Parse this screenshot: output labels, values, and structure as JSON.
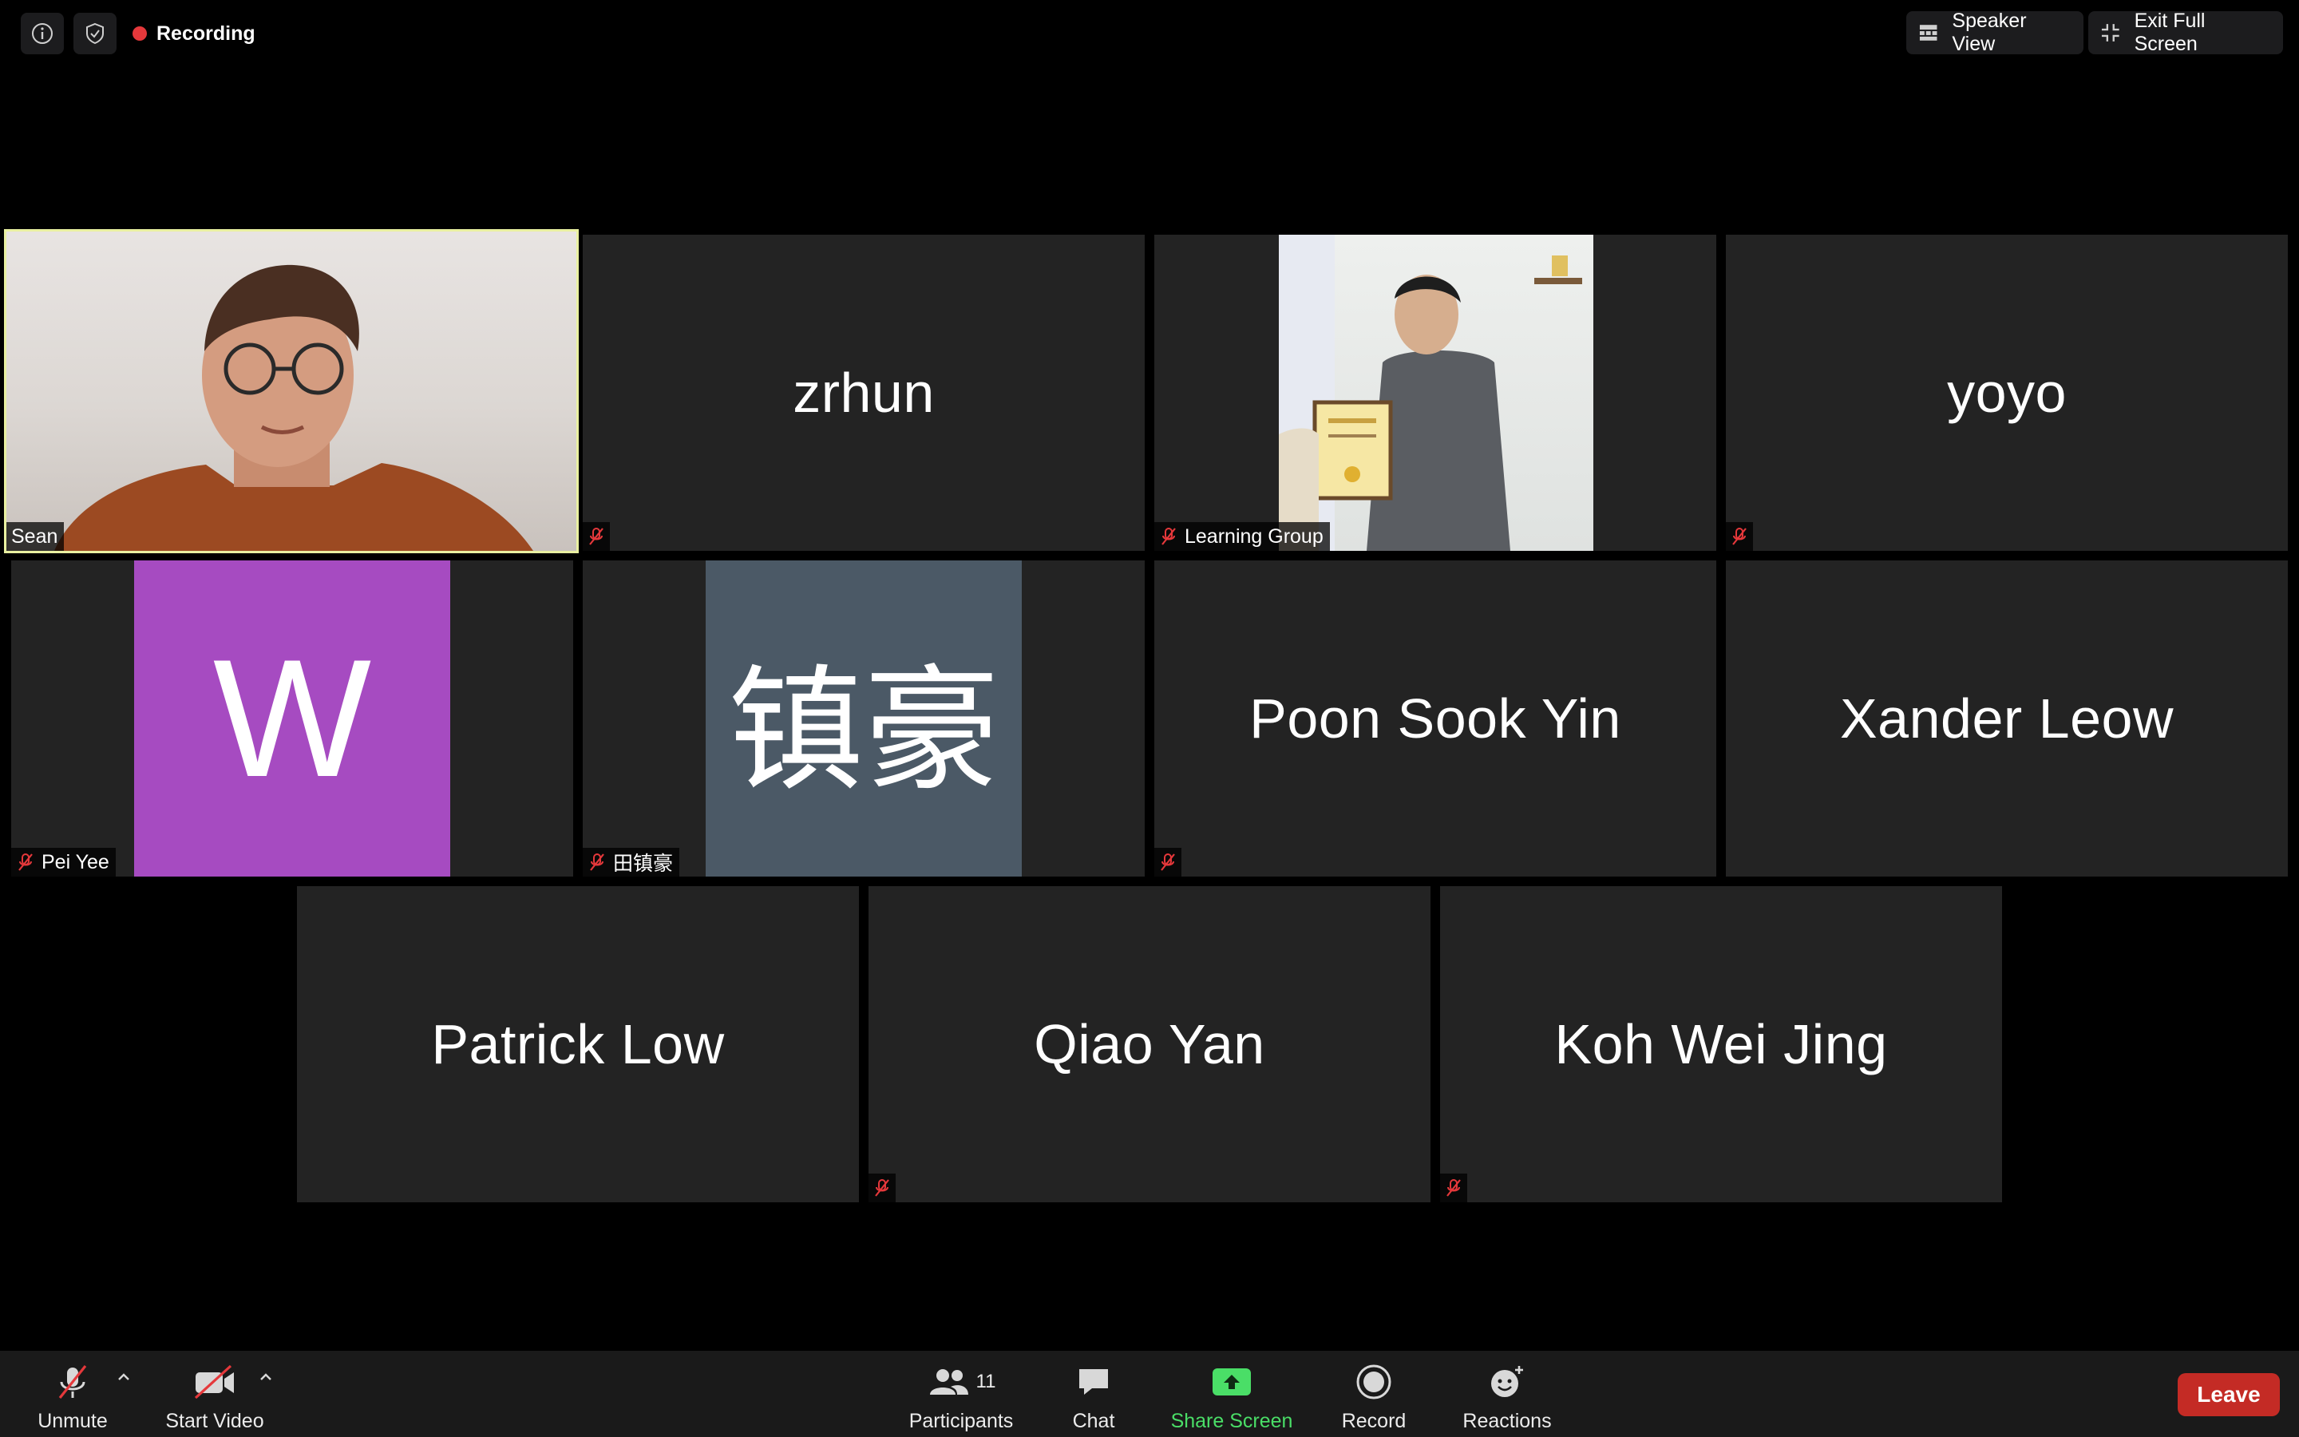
{
  "topbar": {
    "info_icon": "info-icon",
    "security_icon": "shield-icon",
    "recording_label": "Recording",
    "speaker_view_label": "Speaker View",
    "exit_fullscreen_label": "Exit Full Screen"
  },
  "participants": [
    {
      "name": "Sean",
      "display": "video",
      "muted": false,
      "active_speaker": true
    },
    {
      "name": "zrhun",
      "display": "name",
      "muted": true
    },
    {
      "name": "Learning Group",
      "display": "video",
      "muted": true
    },
    {
      "name": "yoyo",
      "display": "name",
      "muted": true
    },
    {
      "name": "Pei Yee",
      "display": "avatar",
      "avatar_text": "W",
      "avatar_color": "#a64bc1",
      "muted": true
    },
    {
      "name": "田镇豪",
      "display": "avatar",
      "avatar_text": "镇豪",
      "avatar_color": "#4b5966",
      "muted": true
    },
    {
      "name": "Poon Sook Yin",
      "display": "name",
      "muted": true
    },
    {
      "name": "Xander Leow",
      "display": "name",
      "muted": false
    },
    {
      "name": "Patrick Low",
      "display": "name",
      "muted": false
    },
    {
      "name": "Qiao Yan",
      "display": "name",
      "muted": true
    },
    {
      "name": "Koh Wei Jing",
      "display": "name",
      "muted": true
    }
  ],
  "toolbar": {
    "unmute_label": "Unmute",
    "start_video_label": "Start Video",
    "participants_label": "Participants",
    "participants_count": "11",
    "chat_label": "Chat",
    "share_screen_label": "Share Screen",
    "record_label": "Record",
    "reactions_label": "Reactions",
    "leave_label": "Leave"
  },
  "colors": {
    "active_speaker_border": "#e9f0a1",
    "recording_dot": "#e5383b",
    "share_green": "#4ade67",
    "leave_red": "#c42b25",
    "muted_red": "#e5383b"
  }
}
